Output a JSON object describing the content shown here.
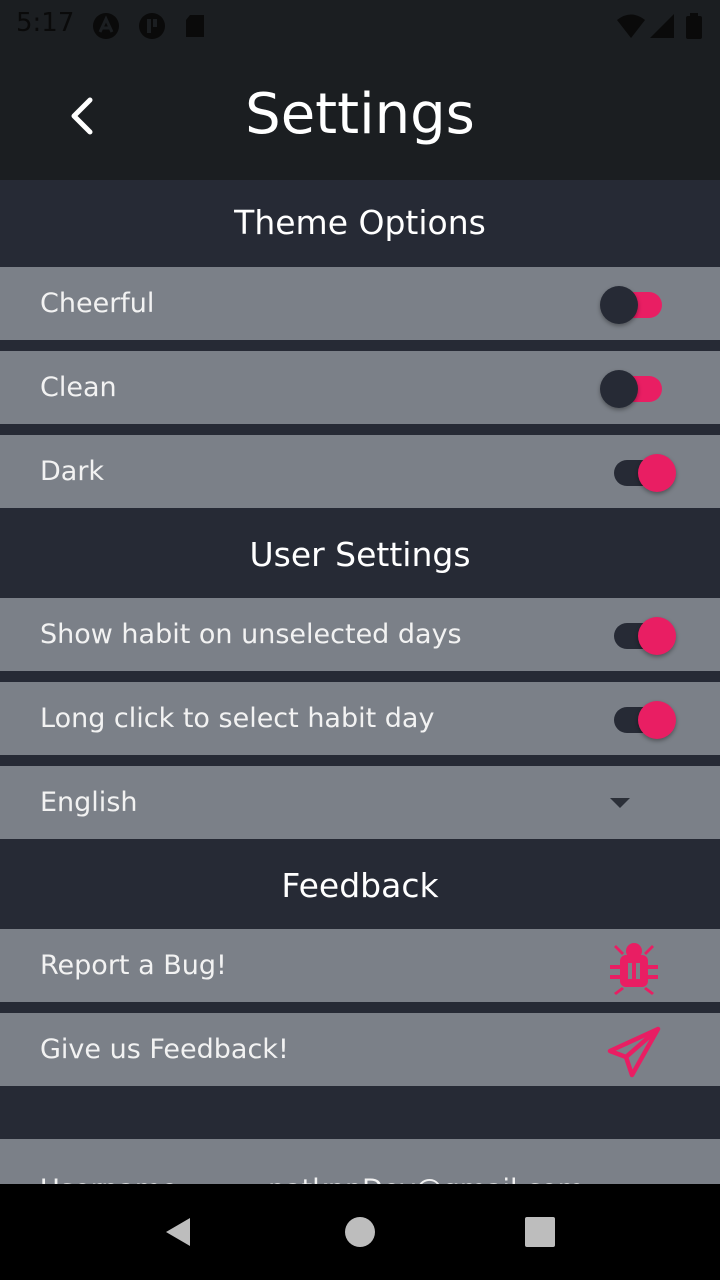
{
  "status_bar": {
    "time": "5:17",
    "left_icons": [
      "a-icon",
      "p-icon",
      "sd-card-icon"
    ],
    "right_icons": [
      "wifi-icon",
      "signal-icon",
      "battery-icon"
    ]
  },
  "app_bar": {
    "title": "Settings",
    "back_icon": "chevron-left-icon"
  },
  "sections": {
    "theme": {
      "title": "Theme Options",
      "items": [
        {
          "label": "Cheerful",
          "enabled": false
        },
        {
          "label": "Clean",
          "enabled": false
        },
        {
          "label": "Dark",
          "enabled": true
        }
      ]
    },
    "user": {
      "title": "User Settings",
      "items": [
        {
          "label": "Show habit on unselected days",
          "enabled": true
        },
        {
          "label": "Long click to select habit day",
          "enabled": true
        }
      ],
      "language": {
        "selected": "English"
      }
    },
    "feedback": {
      "title": "Feedback",
      "items": [
        {
          "label": "Report a Bug!",
          "icon": "bug-icon"
        },
        {
          "label": "Give us Feedback!",
          "icon": "paper-plane-icon"
        }
      ]
    },
    "account": {
      "username_label": "Username:",
      "username_value": "patkppDev@gmail.com"
    }
  },
  "colors": {
    "accent": "#e91e63",
    "background": "#262a35",
    "row": "#7b8088",
    "app_bar": "#1b1e21"
  }
}
